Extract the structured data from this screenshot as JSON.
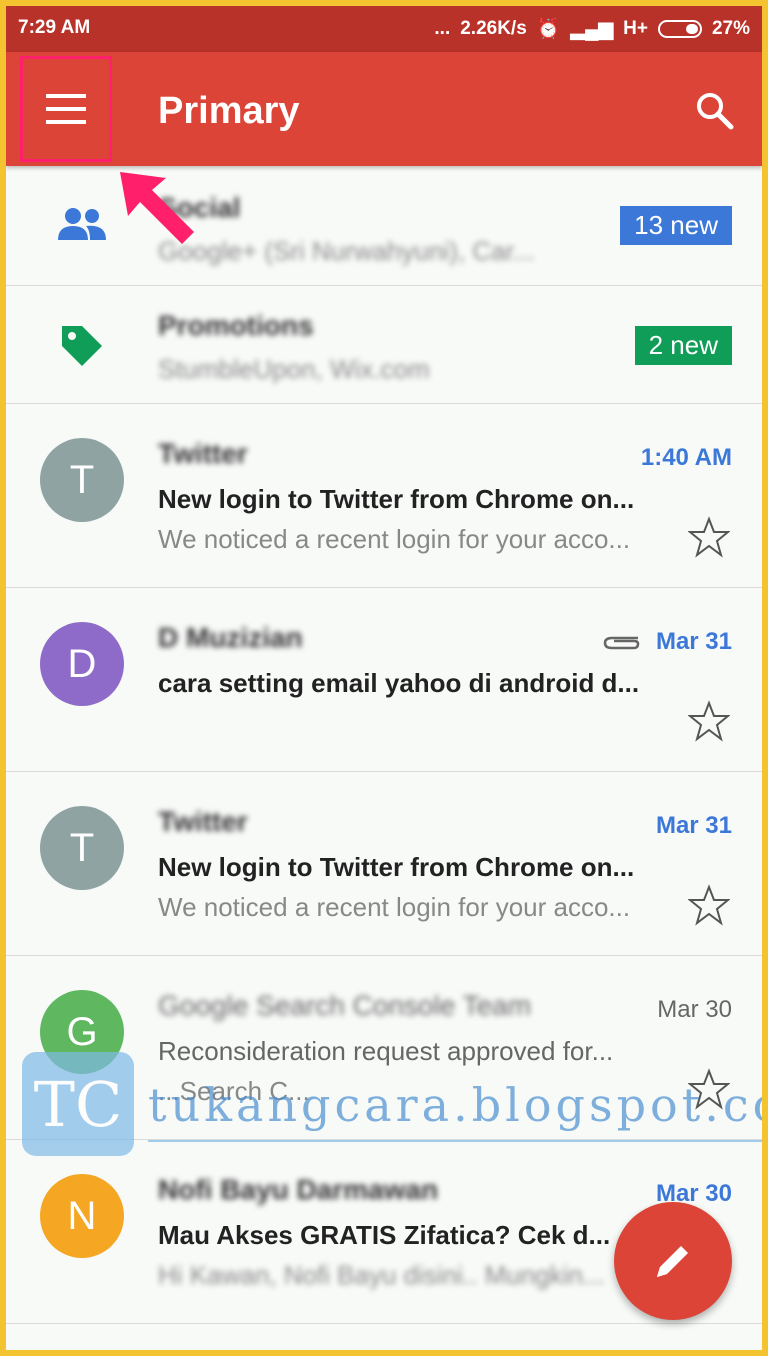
{
  "status_bar": {
    "time": "7:29 AM",
    "dots": "...",
    "speed": "2.26K/s",
    "network": "H+",
    "battery": "27%"
  },
  "appbar": {
    "title": "Primary"
  },
  "categories": [
    {
      "name": "Social",
      "senders": "Google+ (Sri Nurwahyuni), Car...",
      "badge": "13 new",
      "badge_color": "#3c78d8",
      "icon": "people-icon"
    },
    {
      "name": "Promotions",
      "senders": "StumbleUpon, Wix.com",
      "badge": "2 new",
      "badge_color": "#0f9d58",
      "icon": "tag-icon"
    }
  ],
  "emails": [
    {
      "avatar": "T",
      "avatar_color": "#8fa3a3",
      "sender": "Twitter",
      "subject": "New login to Twitter from Chrome on...",
      "snippet": "We noticed a recent login for your acco...",
      "date": "1:40 AM",
      "unread": true,
      "attachment": false
    },
    {
      "avatar": "D",
      "avatar_color": "#8e6bc8",
      "sender": "D Muzizian",
      "subject": "cara setting email yahoo di android d...",
      "snippet": "",
      "date": "Mar 31",
      "unread": true,
      "attachment": true
    },
    {
      "avatar": "T",
      "avatar_color": "#8fa3a3",
      "sender": "Twitter",
      "subject": "New login to Twitter from Chrome on...",
      "snippet": "We noticed a recent login for your acco...",
      "date": "Mar 31",
      "unread": true,
      "attachment": false
    },
    {
      "avatar": "G",
      "avatar_color": "#5fb760",
      "sender": "Google Search Console Team",
      "subject": "Reconsideration request approved for...",
      "snippet": "...Search C...",
      "date": "Mar 30",
      "unread": false,
      "attachment": false
    },
    {
      "avatar": "N",
      "avatar_color": "#f5a623",
      "sender": "Nofi Bayu Darmawan",
      "subject": "Mau Akses GRATIS Zifatica? Cek d...",
      "snippet": "Hi Kawan, Nofi Bayu disini.. Mungkin...",
      "date": "Mar 30",
      "unread": true,
      "attachment": false
    }
  ],
  "watermark": {
    "logo": "TC",
    "text": "tukangcara.blogspot.com"
  }
}
